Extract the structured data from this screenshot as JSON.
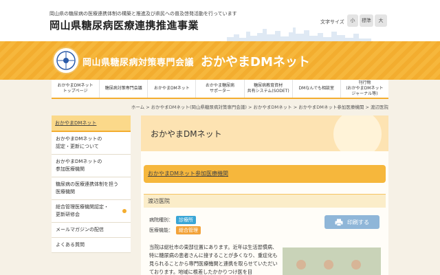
{
  "header": {
    "tagline": "岡山県の糖尿病の医療連携体制の構築と推進及び県民への普及啓発活動を行っています",
    "site_title": "岡山県糖尿病医療連携推進事業",
    "font_size_label": "文字サイズ",
    "font_size_small": "小",
    "font_size_medium": "標準",
    "font_size_large": "大"
  },
  "banner": {
    "org": "岡山県糖尿病対策専門会議",
    "brand": "おかやまDMネット",
    "background_color": "#f6b73c",
    "logo_icon": "dm-net-logo-icon"
  },
  "nav": {
    "items": [
      "おかやまDMネット\nトップページ",
      "糖尿病対策専門会議",
      "おかやまDMネット",
      "おかやま糖尿病\nサポーター",
      "糖尿病教育資材\n共有システム(SODET)",
      "DMなんでも相談室",
      "刊行物\n(おかやまDMネット\nジャーナル等)"
    ]
  },
  "breadcrumb": {
    "items": [
      "ホーム",
      "おかやまDMネット(岡山県糖尿病対策専門会議)",
      "おかやまDMネット",
      "おかやまDMネット参加医療機関",
      "渡辺医院"
    ],
    "separator": ">"
  },
  "sidebar": {
    "head": "おかやまDMネット",
    "items": [
      "おかやまDMネットの\n認定・更新について",
      "おかやまDMネットの\n参加医療機関",
      "糖尿病の医療連携体制を担う\n医療機関",
      "総合管理医療機関認定・\n更新研修会",
      "メールマガジンの配信",
      "よくある質問"
    ]
  },
  "main": {
    "heading": "おかやまDMネット",
    "section_title": "おかやまDMネット参加医療機関",
    "clinic_name": "渡辺医院",
    "type_label": "病院種別：",
    "type_badge": "診療所",
    "function_label": "医療機能：",
    "function_badge": "総合管理",
    "print_label": "印刷する",
    "print_icon": "printer-icon",
    "description": "当院は総社市の東部位置にあります。近年は生活習慣病、特に糖尿病の患者さんに接することが多くなり、重症化も見られることから専門医療機関と連携を取らせていただいております。地域に根差したかかりつけ医を目"
  },
  "colors": {
    "accent": "#f3ad2f",
    "badge_blue": "#3aa6d6",
    "badge_orange": "#f3a33a",
    "print_button": "#8fb6d8"
  }
}
